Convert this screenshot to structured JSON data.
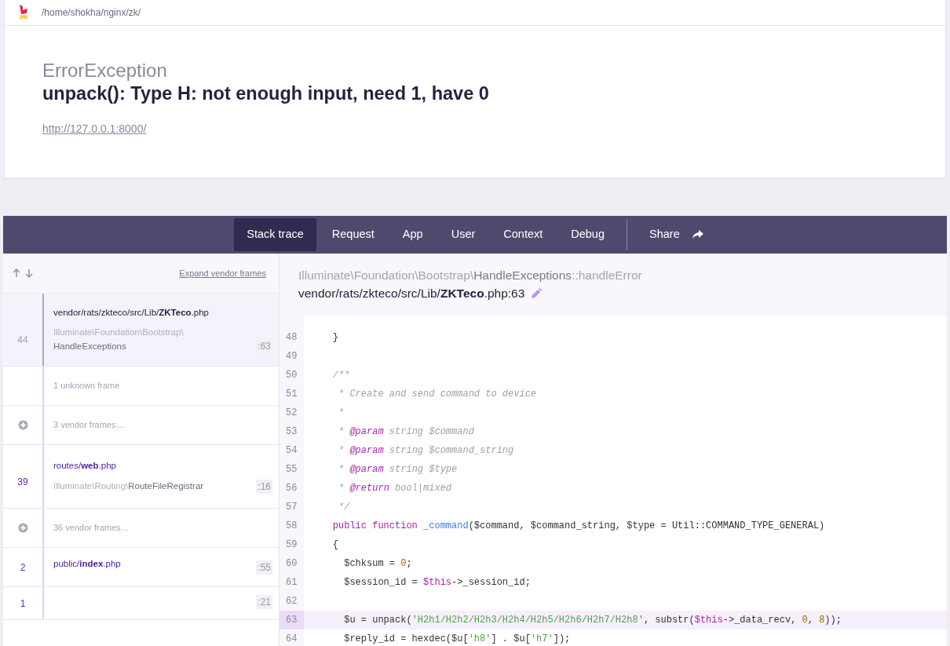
{
  "header": {
    "location": "/home/shokha/nginx/zk/",
    "exception_class": "ErrorException",
    "message": "unpack(): Type H: not enough input, need 1, have 0",
    "url": "http://127.0.0.1:8000/"
  },
  "tabs": [
    {
      "label": "Stack trace",
      "selected": true
    },
    {
      "label": "Request",
      "selected": false
    },
    {
      "label": "App",
      "selected": false
    },
    {
      "label": "User",
      "selected": false
    },
    {
      "label": "Context",
      "selected": false
    },
    {
      "label": "Debug",
      "selected": false
    }
  ],
  "share": {
    "label": "Share"
  },
  "frames_header": {
    "expand_link": "Expand vendor frames"
  },
  "frames": [
    {
      "kind": "frame",
      "number": "44",
      "vendor": true,
      "selected": true,
      "file": "vendor/rats/zkteco/src/Lib/**ZKTeco**.php",
      "namespace": "Illuminate\\Foundation\\Bootstrap\\",
      "class": "HandleExceptions",
      "line": ":63"
    },
    {
      "kind": "unknown",
      "label": "1 unknown frame"
    },
    {
      "kind": "collapsed",
      "label": "3 vendor frames…"
    },
    {
      "kind": "frame",
      "number": "39",
      "vendor": false,
      "selected": false,
      "file": "routes/**web**.php",
      "namespace": "Illuminate\\Routing\\",
      "class": "RouteFileRegistrar",
      "line": ":16"
    },
    {
      "kind": "collapsed",
      "label": "36 vendor frames…"
    },
    {
      "kind": "frame",
      "number": "2",
      "vendor": false,
      "selected": false,
      "file": "public/**index**.php",
      "line": ":55"
    },
    {
      "kind": "frame",
      "number": "1",
      "vendor": false,
      "selected": false,
      "line": ":21"
    }
  ],
  "detail": {
    "namespace": "Illuminate\\Foundation\\Bootstrap\\",
    "class": "HandleExceptions",
    "method": "::handleError",
    "file": "vendor/rats/zkteco/src/Lib/**ZKTeco**.php:63"
  },
  "code_lines": [
    {
      "number": "48",
      "highlighted": false,
      "tokens": [
        {
          "kind": "plain",
          "text": "    }"
        }
      ]
    },
    {
      "number": "49",
      "highlighted": false
    },
    {
      "number": "50",
      "highlighted": false,
      "tokens": [
        {
          "kind": "comment",
          "text": "    /**"
        }
      ]
    },
    {
      "number": "51",
      "highlighted": false,
      "tokens": [
        {
          "kind": "comment",
          "text": "     * Create and send command to device"
        }
      ]
    },
    {
      "number": "52",
      "highlighted": false,
      "tokens": [
        {
          "kind": "comment",
          "text": "     *"
        }
      ]
    },
    {
      "number": "53",
      "highlighted": false,
      "tokens": [
        {
          "kind": "comment",
          "text": "     * "
        },
        {
          "kind": "tag",
          "text": "@param"
        },
        {
          "kind": "comment",
          "text": " string $command"
        }
      ]
    },
    {
      "number": "54",
      "highlighted": false,
      "tokens": [
        {
          "kind": "comment",
          "text": "     * "
        },
        {
          "kind": "tag",
          "text": "@param"
        },
        {
          "kind": "comment",
          "text": " string $command_string"
        }
      ]
    },
    {
      "number": "55",
      "highlighted": false,
      "tokens": [
        {
          "kind": "comment",
          "text": "     * "
        },
        {
          "kind": "tag",
          "text": "@param"
        },
        {
          "kind": "comment",
          "text": " string $type"
        }
      ]
    },
    {
      "number": "56",
      "highlighted": false,
      "tokens": [
        {
          "kind": "comment",
          "text": "     * "
        },
        {
          "kind": "tag",
          "text": "@return"
        },
        {
          "kind": "comment",
          "text": " bool|mixed"
        }
      ]
    },
    {
      "number": "57",
      "highlighted": false,
      "tokens": [
        {
          "kind": "comment",
          "text": "     */"
        }
      ]
    },
    {
      "number": "58",
      "highlighted": false,
      "tokens": [
        {
          "kind": "keyword",
          "text": "    public function"
        },
        {
          "kind": "function",
          "text": " _command"
        },
        {
          "kind": "plain",
          "text": "($command, $command_string, $type = Util::COMMAND_TYPE_GENERAL)"
        }
      ]
    },
    {
      "number": "59",
      "highlighted": false,
      "tokens": [
        {
          "kind": "plain",
          "text": "    {"
        }
      ]
    },
    {
      "number": "60",
      "highlighted": false,
      "tokens": [
        {
          "kind": "plain",
          "text": "      $chksum = "
        },
        {
          "kind": "number",
          "text": "0"
        },
        {
          "kind": "plain",
          "text": ";"
        }
      ]
    },
    {
      "number": "61",
      "highlighted": false,
      "tokens": [
        {
          "kind": "plain",
          "text": "      $session_id = "
        },
        {
          "kind": "keyword",
          "text": "$this"
        },
        {
          "kind": "plain",
          "text": "->_session_id;"
        }
      ]
    },
    {
      "number": "62",
      "highlighted": false
    },
    {
      "number": "63",
      "highlighted": true,
      "tokens": [
        {
          "kind": "plain",
          "text": "      $u = unpack("
        },
        {
          "kind": "string",
          "text": "'H2h1/H2h2/H2h3/H2h4/H2h5/H2h6/H2h7/H2h8'"
        },
        {
          "kind": "plain",
          "text": ", substr("
        },
        {
          "kind": "keyword",
          "text": "$this"
        },
        {
          "kind": "plain",
          "text": "->_data_recv, "
        },
        {
          "kind": "number",
          "text": "0"
        },
        {
          "kind": "plain",
          "text": ", "
        },
        {
          "kind": "number",
          "text": "8"
        },
        {
          "kind": "plain",
          "text": "));"
        }
      ]
    },
    {
      "number": "64",
      "highlighted": false,
      "tokens": [
        {
          "kind": "plain",
          "text": "      $reply_id = hexdec($u["
        },
        {
          "kind": "string",
          "text": "'h8'"
        },
        {
          "kind": "plain",
          "text": "] . $u["
        },
        {
          "kind": "string",
          "text": "'h7'"
        },
        {
          "kind": "plain",
          "text": "]);"
        }
      ]
    }
  ]
}
